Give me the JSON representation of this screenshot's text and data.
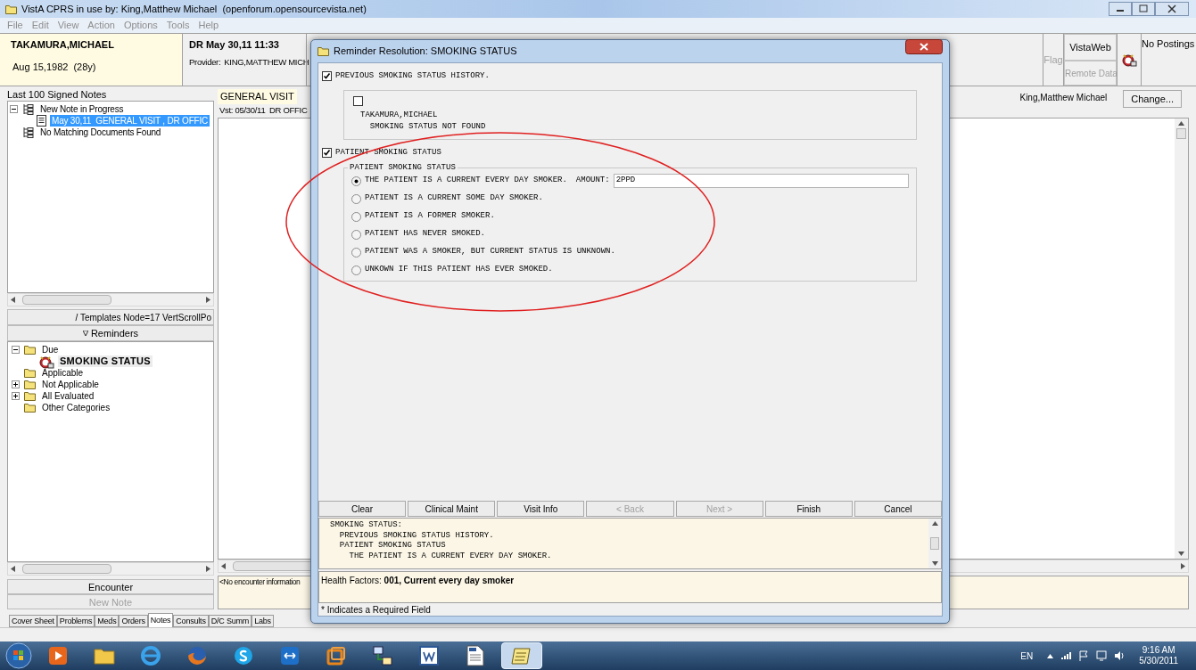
{
  "window": {
    "title": "VistA CPRS in use by: King,Matthew Michael  (openforum.opensourcevista.net)"
  },
  "menu": {
    "disabled": true,
    "items": [
      "File",
      "Edit",
      "View",
      "Action",
      "Options",
      "Tools",
      "Help"
    ]
  },
  "patient": {
    "name": "TAKAMURA,MICHAEL",
    "dob": "Aug 15,1982",
    "age": "(28y)"
  },
  "visit": {
    "title": "DR May 30,11 11:33",
    "provider_label": "Provider:",
    "provider": "KING,MATTHEW MICH"
  },
  "header_right": {
    "flag": {
      "label": "Flag",
      "disabled": true
    },
    "vistaweb": {
      "label": "VistaWeb",
      "disabled": false
    },
    "remote_data": {
      "label": "Remote Data",
      "disabled": true
    },
    "postings": "No Postings"
  },
  "notes_panel": {
    "title": "Last 100 Signed Notes",
    "tree": [
      {
        "kind": "group",
        "label": "New Note in Progress",
        "expanded": true,
        "selected": false,
        "children": [
          {
            "kind": "note",
            "label": "May 30,11  GENERAL VISIT , DR OFFIC",
            "selected": true
          }
        ]
      },
      {
        "kind": "group",
        "label": "No Matching Documents Found",
        "selected": false
      }
    ]
  },
  "templates_button": "/ Templates Node=17 VertScrollPo",
  "reminders_button": "Reminders",
  "reminders_tree": [
    {
      "kind": "folder",
      "label": "Due",
      "expanded": true,
      "selected": false,
      "children": [
        {
          "kind": "reminder",
          "label": "SMOKING STATUS",
          "selected": true
        }
      ]
    },
    {
      "kind": "folder",
      "label": "Applicable",
      "selected": false
    },
    {
      "kind": "folder",
      "label": "Not Applicable",
      "expanded": false,
      "selected": false
    },
    {
      "kind": "folder",
      "label": "All Evaluated",
      "expanded": false,
      "selected": false
    },
    {
      "kind": "folder",
      "label": "Other Categories",
      "selected": false
    }
  ],
  "left_buttons": [
    {
      "label": "Encounter",
      "disabled": false
    },
    {
      "label": "New Note",
      "disabled": true
    }
  ],
  "note": {
    "title": "GENERAL VISIT",
    "visit": "Vst: 05/30/11  DR OFFIC",
    "author": "King,Matthew Michael",
    "change_button": "Change...",
    "encounter_info": "<No encounter information"
  },
  "tabs": [
    {
      "label": "Cover Sheet",
      "selected": false
    },
    {
      "label": "Problems",
      "selected": false
    },
    {
      "label": "Meds",
      "selected": false
    },
    {
      "label": "Orders",
      "selected": false
    },
    {
      "label": "Notes",
      "selected": true
    },
    {
      "label": "Consults",
      "selected": false
    },
    {
      "label": "D/C Summ",
      "selected": false
    },
    {
      "label": "Labs",
      "selected": false
    }
  ],
  "dialog": {
    "title": "Reminder Resolution: SMOKING STATUS",
    "sections": [
      {
        "checked": true,
        "label": "PREVIOUS SMOKING STATUS HISTORY.",
        "group": {
          "kind": "history",
          "checked": false,
          "lines": [
            "TAKAMURA,MICHAEL",
            "  SMOKING STATUS NOT FOUND"
          ]
        }
      },
      {
        "checked": true,
        "label": "PATIENT SMOKING STATUS",
        "group": {
          "kind": "choices",
          "title": "PATIENT SMOKING STATUS",
          "options": [
            {
              "label": "THE PATIENT IS A CURRENT EVERY DAY SMOKER.",
              "selected": true,
              "amount": {
                "label": "AMOUNT:",
                "value": "2PPD"
              }
            },
            {
              "label": "PATIENT IS A CURRENT SOME DAY SMOKER.",
              "selected": false
            },
            {
              "label": "PATIENT IS A FORMER SMOKER.",
              "selected": false
            },
            {
              "label": "PATIENT HAS NEVER SMOKED.",
              "selected": false
            },
            {
              "label": "PATIENT WAS A SMOKER, BUT CURRENT STATUS IS UNKNOWN.",
              "selected": false
            },
            {
              "label": "UNKOWN IF THIS PATIENT HAS EVER SMOKED.",
              "selected": false
            }
          ]
        }
      }
    ],
    "buttons": [
      {
        "label": "Clear",
        "disabled": false
      },
      {
        "label": "Clinical Maint",
        "disabled": false
      },
      {
        "label": "Visit Info",
        "disabled": false
      },
      {
        "label": "< Back",
        "disabled": true
      },
      {
        "label": "Next >",
        "disabled": true
      },
      {
        "label": "Finish",
        "disabled": false
      },
      {
        "label": "Cancel",
        "disabled": false
      }
    ],
    "preview": [
      "SMOKING STATUS:",
      "  PREVIOUS SMOKING STATUS HISTORY.",
      "  PATIENT SMOKING STATUS",
      "    THE PATIENT IS A CURRENT EVERY DAY SMOKER."
    ],
    "health_factors": "Health Factors: **001, Current every day smoker**",
    "required_note": "* Indicates a Required Field"
  },
  "taskbar": {
    "items": [
      {
        "kind": "media",
        "selected": false
      },
      {
        "kind": "folder",
        "selected": false
      },
      {
        "kind": "browser",
        "selected": false
      },
      {
        "kind": "firefox",
        "selected": false
      },
      {
        "kind": "chat",
        "selected": false
      },
      {
        "kind": "remote",
        "selected": false
      },
      {
        "kind": "window",
        "selected": false
      },
      {
        "kind": "network",
        "selected": false
      },
      {
        "kind": "word",
        "selected": false
      },
      {
        "kind": "document",
        "selected": false
      },
      {
        "kind": "notepad",
        "selected": true
      }
    ],
    "language": "EN",
    "time": "9:16 AM",
    "date": "5/30/2011"
  }
}
